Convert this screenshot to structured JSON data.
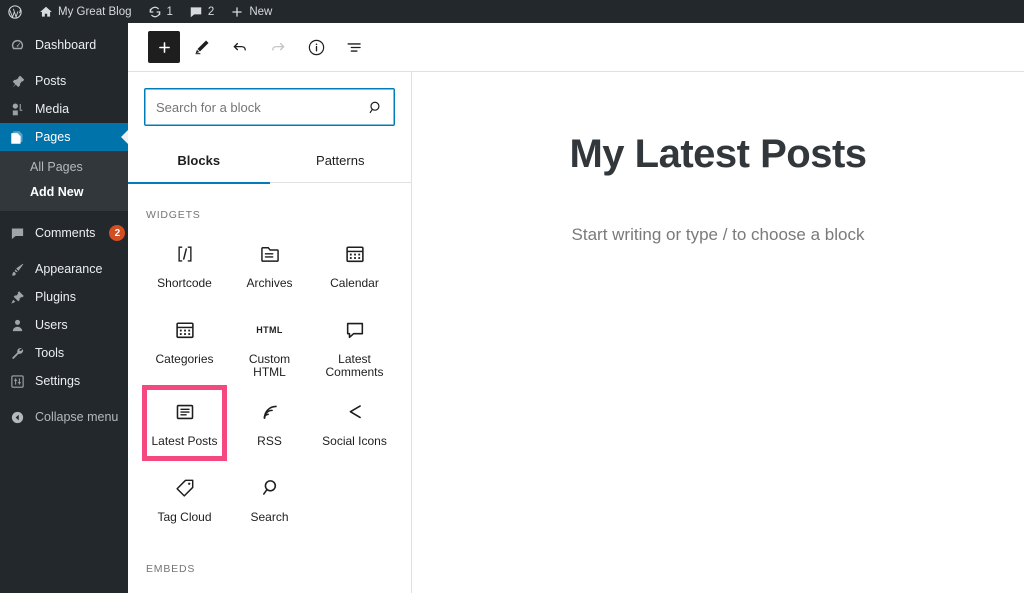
{
  "adminbar": {
    "wp_logo_icon": "wordpress-logo-icon",
    "site_name": "My Great Blog",
    "site_icon": "home-icon",
    "updates_icon": "updates-icon",
    "updates_count": "1",
    "comments_icon": "comment-bubble-icon",
    "comments_count": "2",
    "new_icon": "plus-icon",
    "new_label": "New"
  },
  "adminmenu": {
    "items": [
      {
        "label": "Dashboard",
        "icon": "dashboard-icon",
        "name": "dashboard"
      },
      {
        "label": "Posts",
        "icon": "pin-icon",
        "name": "posts"
      },
      {
        "label": "Media",
        "icon": "media-icon",
        "name": "media"
      },
      {
        "label": "Pages",
        "icon": "pages-icon",
        "name": "pages"
      },
      {
        "label": "Comments",
        "icon": "comment-bubble-icon",
        "name": "comments",
        "badge": "2"
      },
      {
        "label": "Appearance",
        "icon": "brush-icon",
        "name": "appearance"
      },
      {
        "label": "Plugins",
        "icon": "plug-icon",
        "name": "plugins"
      },
      {
        "label": "Users",
        "icon": "user-icon",
        "name": "users"
      },
      {
        "label": "Tools",
        "icon": "wrench-icon",
        "name": "tools"
      },
      {
        "label": "Settings",
        "icon": "settings-sliders-icon",
        "name": "settings"
      }
    ],
    "submenu": {
      "all_pages": "All Pages",
      "add_new": "Add New"
    },
    "collapse": {
      "label": "Collapse menu",
      "icon": "collapse-arrow-icon"
    },
    "active_item": "Pages",
    "active_submenu": "Add New",
    "accent_color": "#0073aa",
    "badge_color": "#d54e21",
    "background_color": "#23282d",
    "submenu_background": "#32373c"
  },
  "toolbar": {
    "add_block_label": "Add block",
    "add_block_icon": "plus-icon",
    "tools_icon": "pencil-icon",
    "undo_icon": "undo-arrow-icon",
    "redo_icon": "redo-arrow-icon",
    "details_icon": "info-circle-icon",
    "list_view_icon": "list-view-icon",
    "redo_disabled": true
  },
  "inserter": {
    "search": {
      "placeholder": "Search for a block",
      "value": "",
      "icon": "search-icon",
      "focus_color": "#007cba"
    },
    "tabs": [
      {
        "label": "Blocks",
        "name": "blocks",
        "active": true
      },
      {
        "label": "Patterns",
        "name": "patterns",
        "active": false
      }
    ],
    "categories": [
      {
        "title": "WIDGETS",
        "blocks": [
          {
            "label": "Shortcode",
            "icon": "shortcode-icon",
            "name": "shortcode",
            "highlighted": false
          },
          {
            "label": "Archives",
            "icon": "archive-folder-icon",
            "name": "archives",
            "highlighted": false
          },
          {
            "label": "Calendar",
            "icon": "calendar-icon",
            "name": "calendar",
            "highlighted": false
          },
          {
            "label": "Categories",
            "icon": "categories-grid-icon",
            "name": "categories",
            "highlighted": false
          },
          {
            "label": "Custom HTML",
            "icon": "html-icon",
            "name": "custom-html",
            "highlighted": false
          },
          {
            "label": "Latest Comments",
            "icon": "comment-bubble-icon",
            "name": "latest-comments",
            "highlighted": false
          },
          {
            "label": "Latest Posts",
            "icon": "latest-posts-icon",
            "name": "latest-posts",
            "highlighted": true
          },
          {
            "label": "RSS",
            "icon": "rss-icon",
            "name": "rss",
            "highlighted": false
          },
          {
            "label": "Social Icons",
            "icon": "share-icon",
            "name": "social-icons",
            "highlighted": false
          },
          {
            "label": "Tag Cloud",
            "icon": "tag-icon",
            "name": "tag-cloud",
            "highlighted": false
          },
          {
            "label": "Search",
            "icon": "search-icon",
            "name": "search-block",
            "highlighted": false
          }
        ]
      },
      {
        "title": "EMBEDS",
        "blocks": []
      }
    ],
    "highlight_color": "#f5487f"
  },
  "canvas": {
    "title": "My Latest Posts",
    "paragraph_placeholder": "Start writing or type / to choose a block"
  }
}
